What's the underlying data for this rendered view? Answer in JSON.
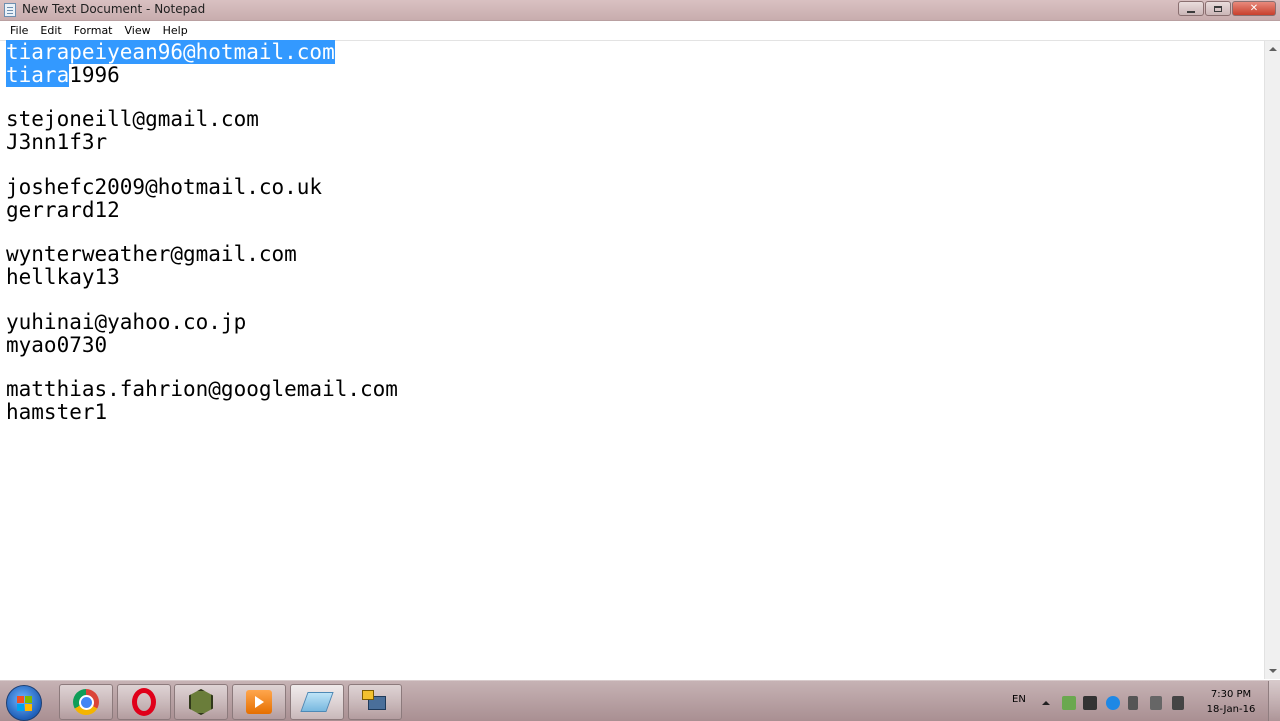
{
  "window": {
    "title": "New Text Document - Notepad",
    "controls": {
      "minimize": "minimize",
      "maximize": "maximize",
      "close": "close"
    }
  },
  "menu": [
    "File",
    "Edit",
    "Format",
    "View",
    "Help"
  ],
  "document": {
    "lines": [
      {
        "selected": "tiarapeiyean96@hotmail.com",
        "rest": ""
      },
      {
        "selected": "tiara",
        "rest": "1996"
      },
      {
        "selected": "",
        "rest": ""
      },
      {
        "selected": "",
        "rest": "stejoneill@gmail.com"
      },
      {
        "selected": "",
        "rest": "J3nn1f3r"
      },
      {
        "selected": "",
        "rest": ""
      },
      {
        "selected": "",
        "rest": "joshefc2009@hotmail.co.uk"
      },
      {
        "selected": "",
        "rest": "gerrard12"
      },
      {
        "selected": "",
        "rest": ""
      },
      {
        "selected": "",
        "rest": "wynterweather@gmail.com"
      },
      {
        "selected": "",
        "rest": "hellkay13"
      },
      {
        "selected": "",
        "rest": ""
      },
      {
        "selected": "",
        "rest": "yuhinai@yahoo.co.jp"
      },
      {
        "selected": "",
        "rest": "myao0730"
      },
      {
        "selected": "",
        "rest": ""
      },
      {
        "selected": "",
        "rest": "matthias.fahrion@googlemail.com"
      },
      {
        "selected": "",
        "rest": "hamster1"
      }
    ],
    "selection_color": "#3399ff"
  },
  "taskbar": {
    "start_icon": "windows-start-icon",
    "apps": [
      {
        "name": "chrome-icon",
        "active": false
      },
      {
        "name": "opera-icon",
        "active": false
      },
      {
        "name": "cube-app-icon",
        "active": false
      },
      {
        "name": "media-player-icon",
        "active": false
      },
      {
        "name": "notepad-icon",
        "active": true
      },
      {
        "name": "network-tool-icon",
        "active": false
      }
    ],
    "tray": {
      "language": "EN",
      "clock_time": "7:30 PM",
      "clock_date": "18-Jan-16"
    }
  }
}
